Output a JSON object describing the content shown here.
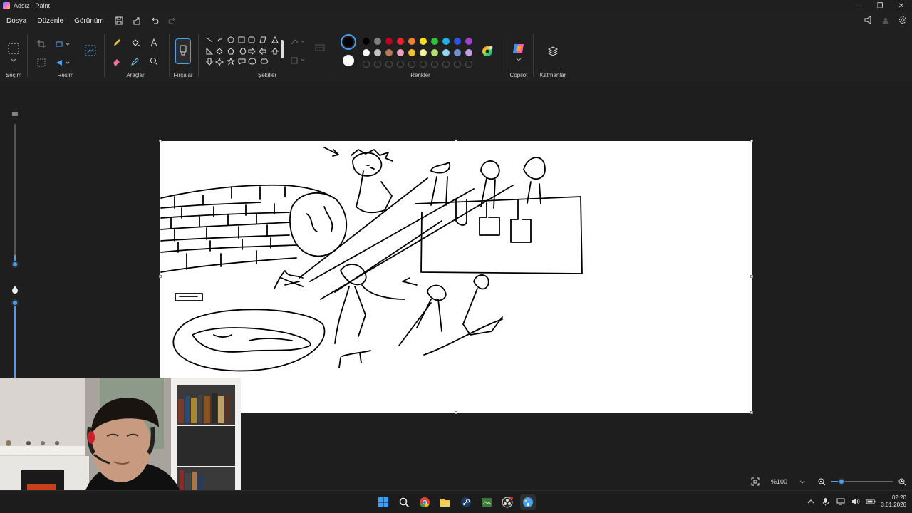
{
  "window": {
    "title": "Adsız - Paint",
    "minimize": "—",
    "restore": "❐",
    "close": "✕"
  },
  "menu": {
    "file": "Dosya",
    "edit": "Düzenle",
    "view": "Görünüm"
  },
  "ribbon": {
    "selection": "Seçim",
    "image": "Resim",
    "tools": "Araçlar",
    "brushes": "Fırçalar",
    "shapes": "Şekiller",
    "colors": "Renkler",
    "copilot": "Copilot",
    "layers": "Katmanlar"
  },
  "palette": {
    "row1": [
      "#000000",
      "#7f7f7f",
      "#c00020",
      "#e8202a",
      "#f08030",
      "#ffe020",
      "#30c040",
      "#20b0e8",
      "#3050e0",
      "#a040d0"
    ],
    "row2": [
      "#ffffff",
      "#c3c3c3",
      "#b87a58",
      "#f0a0c0",
      "#f5c030",
      "#f0f0a0",
      "#b0e070",
      "#90d8f0",
      "#7090d0",
      "#c0a0e0"
    ],
    "primary": "#000000",
    "secondary": "#ffffff"
  },
  "status": {
    "zoom": "%100"
  },
  "taskbar": {
    "time": "02:20",
    "date": "3.01.2026"
  }
}
